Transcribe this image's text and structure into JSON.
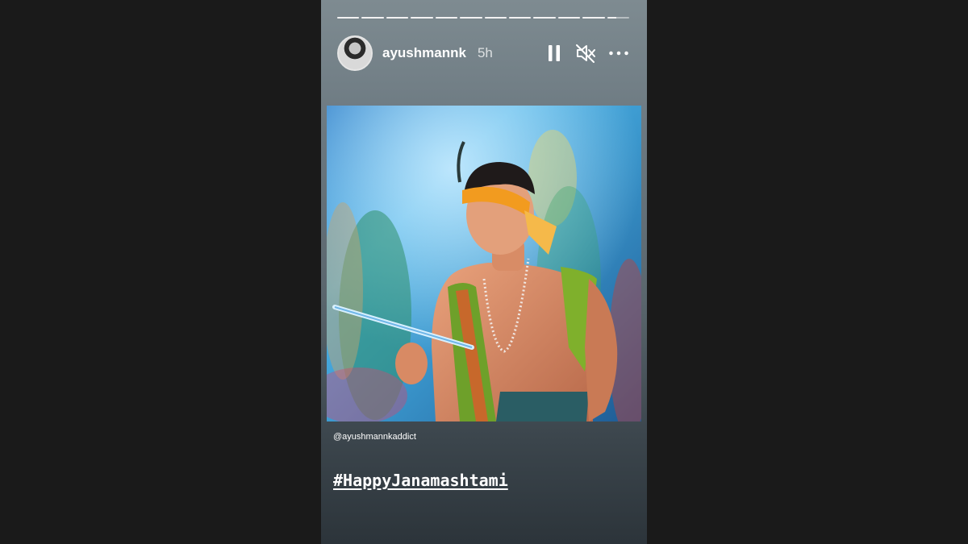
{
  "story": {
    "progress": {
      "segments": 12,
      "completed": 11,
      "current_fraction": 0.4
    },
    "user": {
      "username": "ayushmannk",
      "time_ago": "5h"
    },
    "controls": [
      "pause-icon",
      "mute-icon",
      "more-icon"
    ],
    "mention": "@ayushmannkaddict",
    "hashtag": "#HappyJanamashtami"
  },
  "colors": {
    "page_bg": "#1a1a1a",
    "text": "#ffffff"
  }
}
